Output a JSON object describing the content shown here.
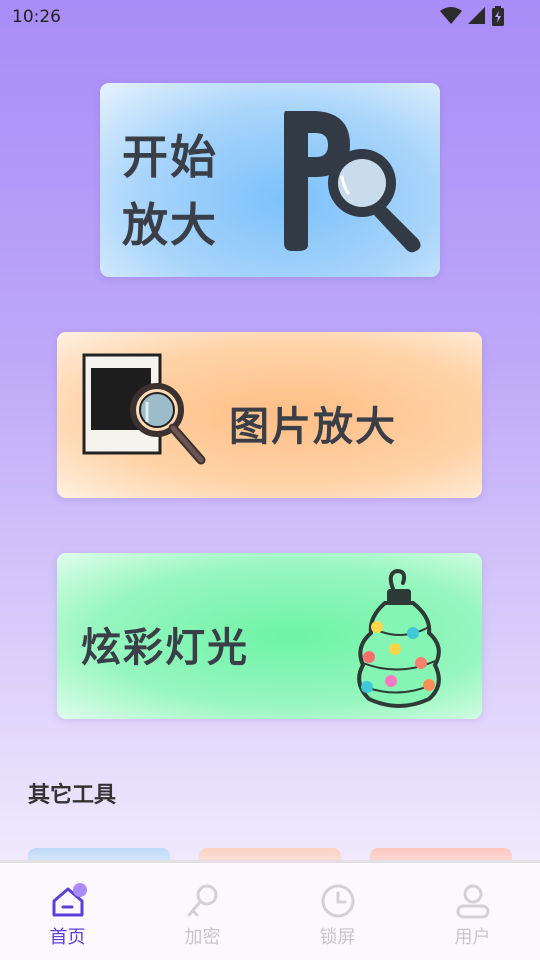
{
  "status_bar": {
    "time": "10:26"
  },
  "cards": {
    "zoom": {
      "line1": "开始",
      "line2": "放大"
    },
    "picture": {
      "label": "图片放大"
    },
    "lights": {
      "label": "炫彩灯光"
    }
  },
  "other_tools": {
    "title": "其它工具"
  },
  "bottom_nav": {
    "items": [
      {
        "label": "首页",
        "icon": "home-icon",
        "active": true
      },
      {
        "label": "加密",
        "icon": "key-icon",
        "active": false
      },
      {
        "label": "锁屏",
        "icon": "clock-icon",
        "active": false
      },
      {
        "label": "用户",
        "icon": "user-icon",
        "active": false
      }
    ]
  },
  "colors": {
    "accent": "#5b3fd6",
    "nav_inactive": "#c9c6ca",
    "zoom_card": "#7cc1fb",
    "picture_card": "#ffbe85",
    "lights_card": "#6df3a6"
  }
}
